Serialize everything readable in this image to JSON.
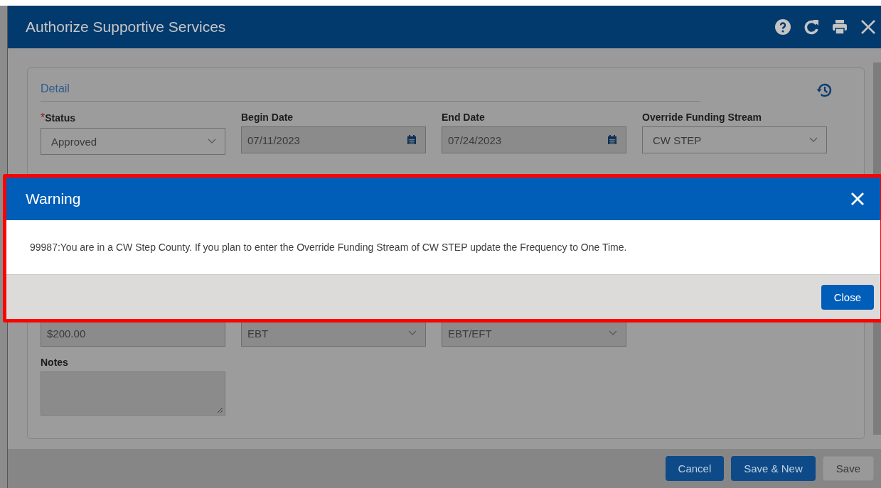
{
  "window": {
    "title": "Authorize Supportive Services"
  },
  "toolbar": [
    {
      "kind": "help"
    },
    {
      "kind": "refresh"
    },
    {
      "kind": "print"
    },
    {
      "kind": "close"
    }
  ],
  "section": {
    "title": "Detail"
  },
  "required_marker": "*",
  "fields": [
    {
      "label": "Status",
      "required": true,
      "kind": "select",
      "value": "Approved"
    },
    {
      "label": "Begin Date",
      "required": false,
      "kind": "date",
      "value": "07/11/2023"
    },
    {
      "label": "End Date",
      "required": false,
      "kind": "date",
      "value": "07/24/2023"
    },
    {
      "label": "Override Funding Stream",
      "required": false,
      "kind": "select",
      "value": "CW STEP"
    }
  ],
  "lower_fields": [
    {
      "kind": "text",
      "value": "$200.00"
    },
    {
      "kind": "select",
      "value": "EBT"
    },
    {
      "kind": "select",
      "value": "EBT/EFT"
    }
  ],
  "notes": {
    "label": "Notes"
  },
  "footer_buttons": [
    {
      "label": "Cancel",
      "kind": "primary"
    },
    {
      "label": "Save & New",
      "kind": "primary"
    },
    {
      "label": "Save",
      "kind": "secondary"
    }
  ],
  "warning": {
    "title": "Warning",
    "message": "99987:You are in a CW Step County. If you plan to enter the Override Funding Stream of CW STEP update the Frequency to One Time.",
    "button": "Close"
  }
}
